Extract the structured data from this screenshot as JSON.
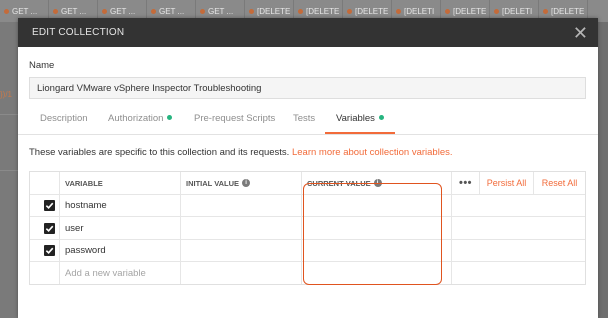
{
  "background": {
    "tabs": [
      {
        "label": "GET ..."
      },
      {
        "label": "GET ..."
      },
      {
        "label": "GET ..."
      },
      {
        "label": "GET ..."
      },
      {
        "label": "GET ..."
      },
      {
        "label": "[DELETE"
      },
      {
        "label": "[DELETE"
      },
      {
        "label": "[DELETE"
      },
      {
        "label": "[DELETI"
      },
      {
        "label": "[DELETE"
      },
      {
        "label": "[DELETI"
      },
      {
        "label": "[DELETE"
      }
    ],
    "left_code": "})/1"
  },
  "modal": {
    "title": "EDIT COLLECTION",
    "close_glyph": "✕",
    "name_label": "Name",
    "name_value": "Liongard VMware vSphere Inspector Troubleshooting",
    "tabs": [
      {
        "label": "Description",
        "dot": false
      },
      {
        "label": "Authorization",
        "dot": true
      },
      {
        "label": "Pre-request Scripts",
        "dot": false
      },
      {
        "label": "Tests",
        "dot": false
      },
      {
        "label": "Variables",
        "dot": true
      }
    ],
    "description_text": "These variables are specific to this collection and its requests. ",
    "description_link": "Learn more about collection variables.",
    "table": {
      "headers": {
        "variable": "VARIABLE",
        "initial_value": "INITIAL VALUE",
        "current_value": "CURRENT VALUE",
        "more": "•••",
        "persist_all": "Persist All",
        "reset_all": "Reset All"
      },
      "rows": [
        {
          "checked": true,
          "variable": "hostname",
          "initial_value": "",
          "current_value": ""
        },
        {
          "checked": true,
          "variable": "user",
          "initial_value": "",
          "current_value": ""
        },
        {
          "checked": true,
          "variable": "password",
          "initial_value": "",
          "current_value": ""
        }
      ],
      "new_row_placeholder": "Add a new variable"
    }
  },
  "colors": {
    "accent": "#f26b3a",
    "header_bg": "#333333",
    "status_dot": "#26b47f",
    "highlight": "#e0541f"
  }
}
